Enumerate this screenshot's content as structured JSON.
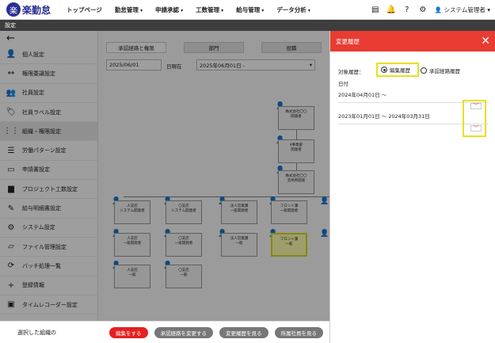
{
  "app": {
    "logo_mark": "楽",
    "logo_text": "楽勤怠"
  },
  "nav": [
    "トップページ",
    "勤怠管理",
    "申請承認",
    "工数管理",
    "給与管理",
    "データ分析"
  ],
  "user": "システム管理者",
  "breadcrumb": "設定",
  "sidebar": {
    "items": [
      {
        "label": "個人設定",
        "icon": "person-icon"
      },
      {
        "label": "権限委譲設定",
        "icon": "arrows-icon"
      },
      {
        "label": "社員設定",
        "icon": "group-icon"
      },
      {
        "label": "社員ラベル設定",
        "icon": "tag-icon"
      },
      {
        "label": "組織・権限設定",
        "icon": "grid-icon"
      },
      {
        "label": "労働パターン設定",
        "icon": "list-icon"
      },
      {
        "label": "申請書設定",
        "icon": "inbox-icon"
      },
      {
        "label": "プロジェクト工数設定",
        "icon": "folder-icon"
      },
      {
        "label": "給与明細書設定",
        "icon": "edit-icon"
      },
      {
        "label": "システム設定",
        "icon": "gear-icon"
      },
      {
        "label": "ファイル管理設定",
        "icon": "folder-open-icon"
      },
      {
        "label": "バッチ処理一覧",
        "icon": "sync-icon"
      },
      {
        "label": "登録情報",
        "icon": "plus-icon"
      },
      {
        "label": "タイムレコーダー設定",
        "icon": "clipboard-icon"
      }
    ]
  },
  "main": {
    "tabs": [
      "承認経路と権限",
      "部門",
      "役職"
    ],
    "date": "2025/06/01",
    "date_label": "日現在",
    "period": "2025年06月01日 -",
    "org_nodes": [
      {
        "text": "株式会社〇〇\n開発者"
      },
      {
        "text": "4事業部\n開発者"
      },
      {
        "text": "株式会社〇〇\n宮崎県開発"
      },
      {
        "text": "人支店\nシステム開発者"
      },
      {
        "text": "〇支店\nシステム開発者"
      },
      {
        "text": "法人営業課\n一般開発者"
      },
      {
        "text": "フロント課\n一般開発者"
      },
      {
        "text": "人支店\n一般開発者"
      },
      {
        "text": "〇支店\n一般開発者"
      },
      {
        "text": "法人営業課\n一般"
      },
      {
        "text": "フロント課\n一般"
      },
      {
        "text": "人支店\n一般"
      },
      {
        "text": "〇支店\n一般"
      }
    ]
  },
  "bottom": {
    "label": "選択した組織の",
    "buttons": [
      "編集をする",
      "承認経路を変更する",
      "変更履歴を見る",
      "所属社員を見る"
    ]
  },
  "panel": {
    "title": "変更履歴",
    "target_label": "対象履歴：",
    "radio1": "編集履歴",
    "radio2": "承認経路履歴",
    "date_head": "日付",
    "history": [
      "2024年04月01日 〜",
      "2023年01月01日 〜 2024年03月31日"
    ]
  },
  "colors": {
    "accent": "#e83c32",
    "highlight": "#e8e020",
    "brand": "#2a2f8f"
  }
}
